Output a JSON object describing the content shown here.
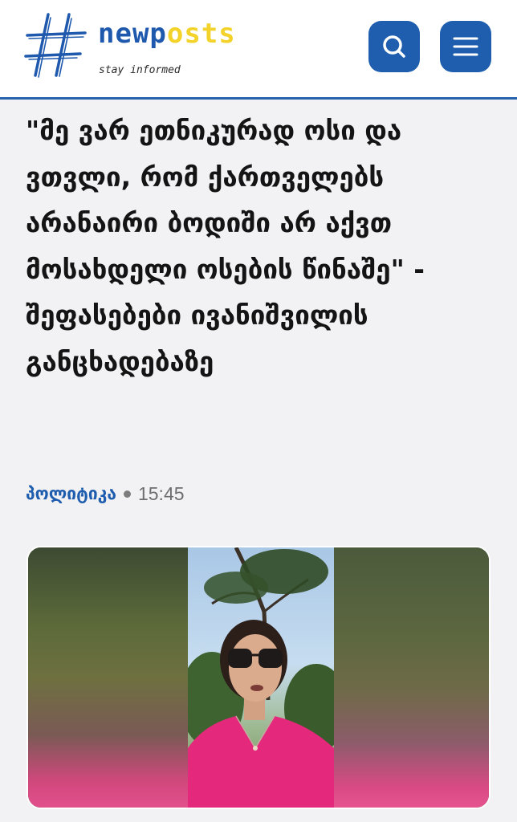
{
  "header": {
    "logo": {
      "wordmark_part1": "newp",
      "wordmark_part2": "osts",
      "tagline": "stay informed"
    },
    "search_icon": "search-icon",
    "menu_icon": "hamburger-menu-icon"
  },
  "article": {
    "headline": "\"მე ვარ ეთნიკურად ოსი და ვთვლი, რომ ქართველებს არანაირი ბოდიში არ აქვთ მოსახდელი ოსების წინაშე\" - შეფასებები ივანიშვილის განცხადებაზე",
    "category": "პოლიტიკა",
    "time": "15:45"
  },
  "colors": {
    "brand_blue": "#1f5eae",
    "brand_yellow": "#f3d229",
    "headline_text": "#141414",
    "meta_gray": "#6e6e6e"
  }
}
